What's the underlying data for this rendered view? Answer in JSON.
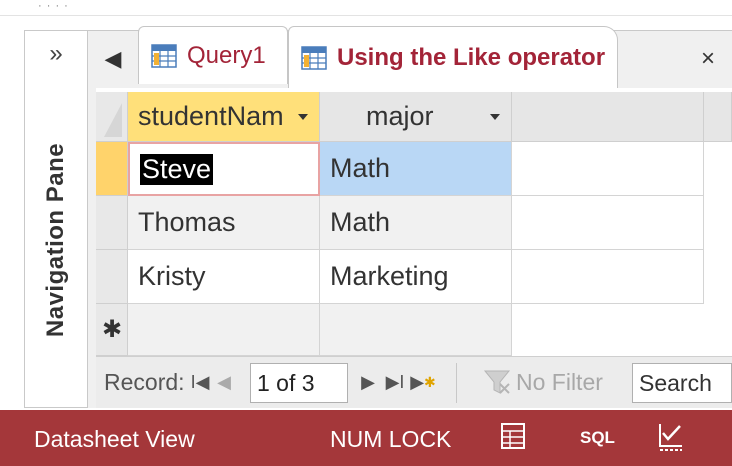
{
  "tabs": [
    {
      "label": "Query1",
      "active": false
    },
    {
      "label": "Using the Like operator",
      "active": true
    }
  ],
  "nav_pane": {
    "expand_glyph": "»",
    "label": "Navigation Pane"
  },
  "tab_controls": {
    "prev_glyph": "◀",
    "close_glyph": "×"
  },
  "grid": {
    "columns": [
      "studentNam",
      "major"
    ],
    "rows": [
      [
        "Steve",
        "Math"
      ],
      [
        "Thomas",
        "Math"
      ],
      [
        "Kristy",
        "Marketing"
      ]
    ],
    "new_row_glyph": "✱"
  },
  "record_nav": {
    "label": "Record:",
    "current": "1 of 3",
    "filter_label": "No Filter",
    "search_placeholder": "Search"
  },
  "status": {
    "view_label": "Datasheet View",
    "num_lock": "NUM LOCK",
    "sql_label": "SQL"
  },
  "icons": [
    "nav-expand-icon",
    "tab-prev-icon",
    "query-icon",
    "close-icon",
    "dropdown-icon",
    "first-record-icon",
    "prev-record-icon",
    "next-record-icon",
    "last-record-icon",
    "new-record-icon",
    "filter-icon",
    "datasheet-view-icon",
    "design-view-icon"
  ],
  "colors": {
    "status_bar": "#a4373a",
    "tab_text": "#a32438",
    "active_header": "#ffe07a",
    "selected_cell": "#b9d7f5",
    "current_row_marker": "#ffd36b",
    "edited_cell_border": "#e8a3a3"
  }
}
